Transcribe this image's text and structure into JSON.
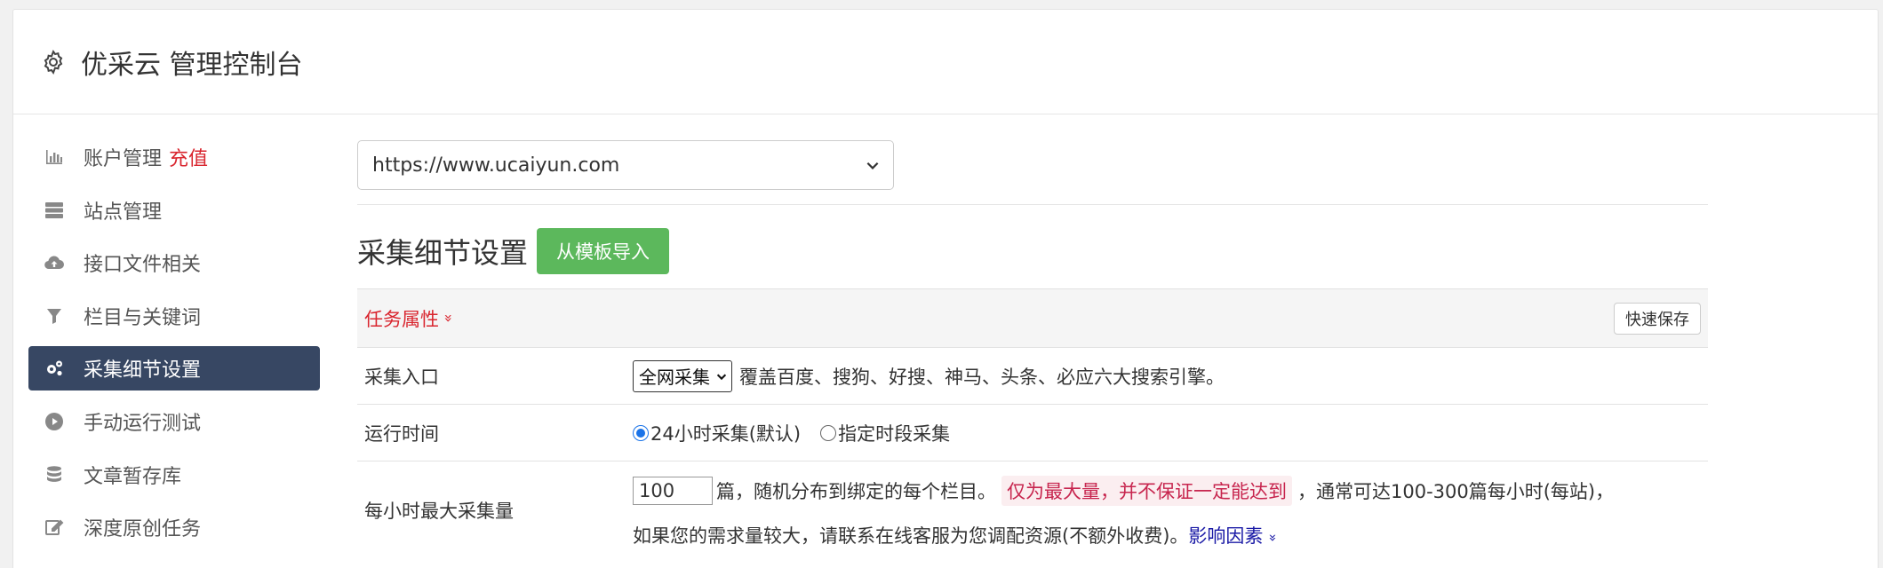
{
  "header": {
    "title": "优采云 管理控制台",
    "icon": "gear-icon"
  },
  "sidebar": {
    "items": [
      {
        "label": "账户管理",
        "badge": "充值",
        "icon": "bar-chart-icon"
      },
      {
        "label": "站点管理",
        "icon": "server-icon"
      },
      {
        "label": "接口文件相关",
        "icon": "cloud-upload-icon"
      },
      {
        "label": "栏目与关键词",
        "icon": "filter-icon"
      },
      {
        "label": "采集细节设置",
        "icon": "gears-icon",
        "active": true
      },
      {
        "label": "手动运行测试",
        "icon": "play-circle-icon"
      },
      {
        "label": "文章暂存库",
        "icon": "database-icon"
      },
      {
        "label": "深度原创任务",
        "icon": "edit-icon"
      }
    ]
  },
  "main": {
    "site_select": {
      "value": "https://www.ucaiyun.com"
    },
    "section_title": "采集细节设置",
    "import_button": "从模板导入",
    "task_attr_label": "任务属性",
    "task_attr_chevron": "»",
    "quick_save": "快速保存",
    "rows": {
      "entry": {
        "label": "采集入口",
        "select_value": "全网采集",
        "desc": "覆盖百度、搜狗、好搜、神马、头条、必应六大搜索引擎。"
      },
      "runtime": {
        "label": "运行时间",
        "option1": "24小时采集(默认)",
        "option2": "指定时段采集"
      },
      "max_per_hour": {
        "label": "每小时最大采集量",
        "input_value": "100",
        "text1": "篇，随机分布到绑定的每个栏目。",
        "warn": "仅为最大量，并不保证一定能达到",
        "text2": "，通常可达100-300篇每小时(每站)，",
        "text3": "如果您的需求量较大，请联系在线客服为您调配资源(不额外收费)。",
        "link": "影响因素",
        "link_chevron": "»"
      }
    }
  },
  "colors": {
    "active_nav": "#374763",
    "accent_red": "#d9262f",
    "import_green": "#5cb85c",
    "radio_blue": "#1a73e8"
  }
}
